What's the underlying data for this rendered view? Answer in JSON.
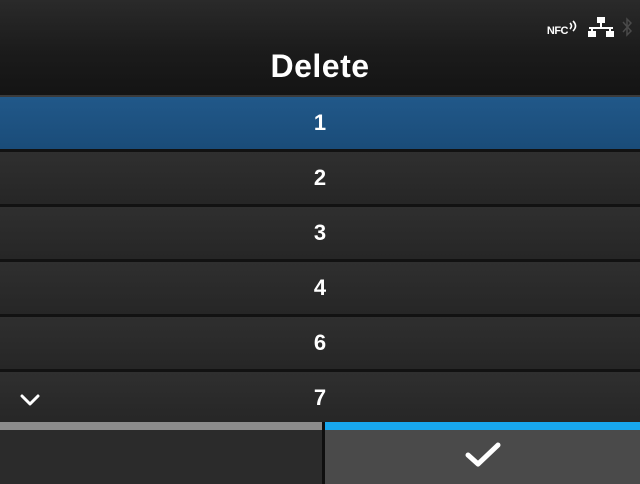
{
  "header": {
    "title": "Delete",
    "status": {
      "nfc_label": "NFC",
      "icons": [
        "nfc-icon",
        "network-icon",
        "bluetooth-icon"
      ]
    }
  },
  "list": {
    "items": [
      "1",
      "2",
      "3",
      "4",
      "6",
      "7"
    ],
    "selected_index": 0,
    "more_indicator": "chevron-down-icon"
  },
  "buttons": {
    "left": {
      "label": "",
      "icon": null
    },
    "right": {
      "label": "",
      "icon": "check-icon"
    }
  },
  "colors": {
    "selected_row": "#1f5485",
    "confirm_accent": "#18a7ee",
    "cancel_accent": "#8c8c8c",
    "background": "#1a1a1a"
  }
}
